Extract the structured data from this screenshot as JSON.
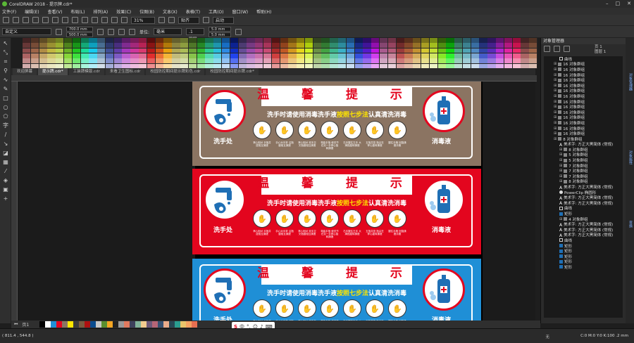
{
  "window": {
    "title": "CorelDRAW 2018 - 提示牌.cdr*",
    "controls": [
      "–",
      "□",
      "✕"
    ]
  },
  "menu": [
    "文件(F)",
    "编辑(E)",
    "查看(V)",
    "布局(L)",
    "排列(A)",
    "效果(C)",
    "位图(B)",
    "文本(X)",
    "表格(T)",
    "工具(O)",
    "窗口(W)",
    "帮助(H)"
  ],
  "toolbar": {
    "zoom": "31%",
    "snap": "贴齐",
    "launch": "启动"
  },
  "propbar": {
    "preset": "自定义",
    "width": "700.0 mm",
    "height": "500.0 mm",
    "units_label": "单位:",
    "units": "毫米",
    "nudge": ".1 mm",
    "dup_x": "5.0 mm",
    "dup_y": "5.0 mm"
  },
  "tabs": [
    "欢迎屏幕",
    "提示牌.cdr*",
    "工装牌模版.cdr",
    "来看卫生图标.cdr",
    "校园防控期间提示牌彩色.cdr",
    "校园防控期间提示牌.cdr*"
  ],
  "active_tab_index": 1,
  "signs": [
    {
      "bg": "#8b7462",
      "title": "温 馨 提 示",
      "sub_pre": "洗手时请使用消毒洗手液",
      "sub_hl": "按照七步法",
      "sub_post": "认真清洗消毒",
      "left_label": "洗手处",
      "right_label": "消毒液"
    },
    {
      "bg": "#e3051e",
      "title": "温 馨 提 示",
      "sub_pre": "洗手时请使用消毒洗手液",
      "sub_hl": "按照七步法",
      "sub_post": "认真清洗消毒",
      "left_label": "洗手处",
      "right_label": "消毒液"
    },
    {
      "bg": "#1f8fd6",
      "title": "温 馨 提 示",
      "sub_pre": "洗手时请使用消毒洗手液",
      "sub_hl": "按照七步法",
      "sub_post": "认真清洗消毒",
      "left_label": "洗手处",
      "right_label": "消毒液"
    }
  ],
  "step_captions": [
    "掌心相对 手指并拢相互揉搓",
    "手心对手背 沿指缝相互揉搓",
    "掌心相对 双手交叉指缝相互揉搓",
    "弯曲手指 使关节在另一手掌心旋转揉搓",
    "右手握住左手 大拇指旋转揉搓",
    "五指并拢 指尖在掌心旋转揉搓",
    "握住手腕 回旋揉搓手腕"
  ],
  "docker": {
    "title": "对象管理器",
    "page": "页 1",
    "layer": "图层 1",
    "items": [
      "曲线",
      "16 对象群组",
      "16 对象群组",
      "16 对象群组",
      "16 对象群组",
      "16 对象群组",
      "16 对象群组",
      "16 对象群组",
      "16 对象群组",
      "16 对象群组",
      "16 对象群组",
      "16 对象群组",
      "16 对象群组",
      "16 对象群组",
      "16 对象群组",
      "8 对象群组",
      "美术字: 方正大黑简体 (常规)",
      "8 对象群组",
      "5 对象群组",
      "5 对象群组",
      "7 对象群组",
      "7 对象群组",
      "7 对象群组",
      "8 对象群组",
      "美术字: 方正大黑简体 (常规)",
      "PowerClip 椭圆形",
      "美术字: 方正大黑简体 (常规)",
      "美术字: 方正大黑简体 (常规)",
      "曲线",
      "矩形",
      "4 对象群组",
      "美术字: 方正大黑简体 (常规)",
      "美术字: 方正大黑简体 (常规)",
      "美术字: 方正大黑简体 (常规)",
      "曲线",
      "矩形",
      "矩形",
      "矩形",
      "矩形",
      "矩形"
    ],
    "vtabs": [
      "对象管理器",
      "对象属性",
      "变换"
    ]
  },
  "pagebar": {
    "page_label": "页1"
  },
  "status": {
    "coords": "( 811.4 , 544.8 )",
    "fill": "C:0 M:0 Y:0 K:100 .2 mm",
    "fill_none": "无"
  },
  "ime": {
    "label": "中"
  }
}
